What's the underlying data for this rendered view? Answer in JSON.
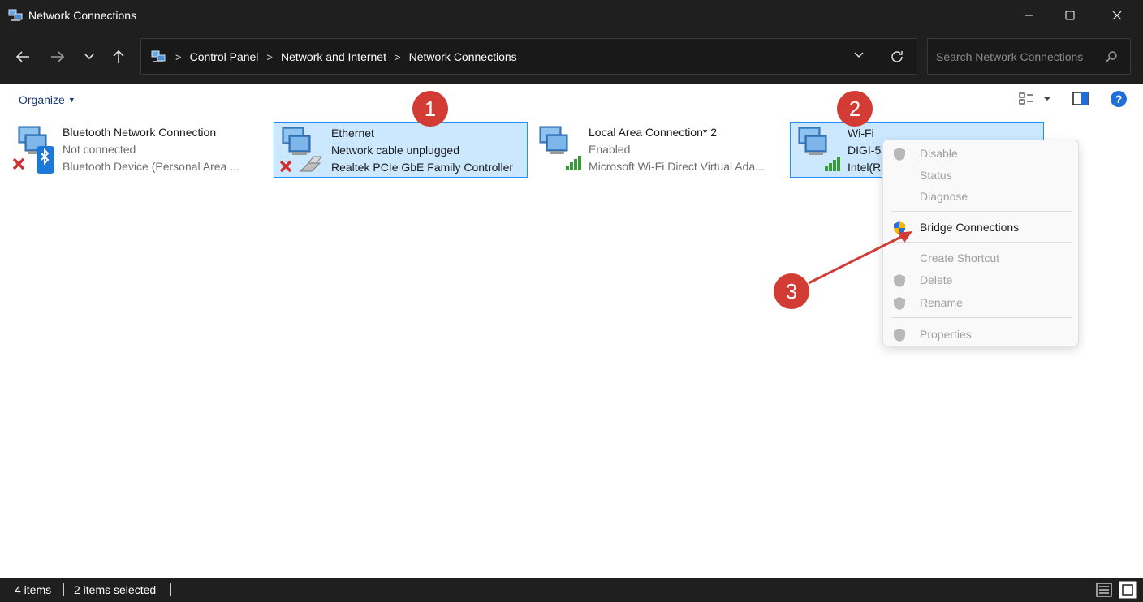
{
  "window": {
    "title": "Network Connections"
  },
  "address": {
    "crumbs": [
      "Control Panel",
      "Network and Internet",
      "Network Connections"
    ],
    "search_placeholder": "Search Network Connections"
  },
  "toolbar": {
    "organize": "Organize"
  },
  "items": [
    {
      "name": "Bluetooth Network Connection",
      "status": "Not connected",
      "device": "Bluetooth Device (Personal Area ...",
      "selected": false
    },
    {
      "name": "Ethernet",
      "status": "Network cable unplugged",
      "device": "Realtek PCIe GbE Family Controller",
      "selected": true
    },
    {
      "name": "Local Area Connection* 2",
      "status": "Enabled",
      "device": "Microsoft Wi-Fi Direct Virtual Ada...",
      "selected": false
    },
    {
      "name": "Wi-Fi",
      "status": "DIGI-5",
      "device": "Intel(R",
      "selected": true
    }
  ],
  "context_menu": {
    "disable": "Disable",
    "status": "Status",
    "diagnose": "Diagnose",
    "bridge": "Bridge Connections",
    "create_shortcut": "Create Shortcut",
    "delete": "Delete",
    "rename": "Rename",
    "properties": "Properties"
  },
  "annotations": {
    "one": "1",
    "two": "2",
    "three": "3"
  },
  "status": {
    "count": "4 items",
    "selected": "2 items selected"
  },
  "colors": {
    "accent": "#1e90ff",
    "selection": "#cce8ff",
    "badge": "#d33b35",
    "chrome": "#1f1f1f"
  }
}
